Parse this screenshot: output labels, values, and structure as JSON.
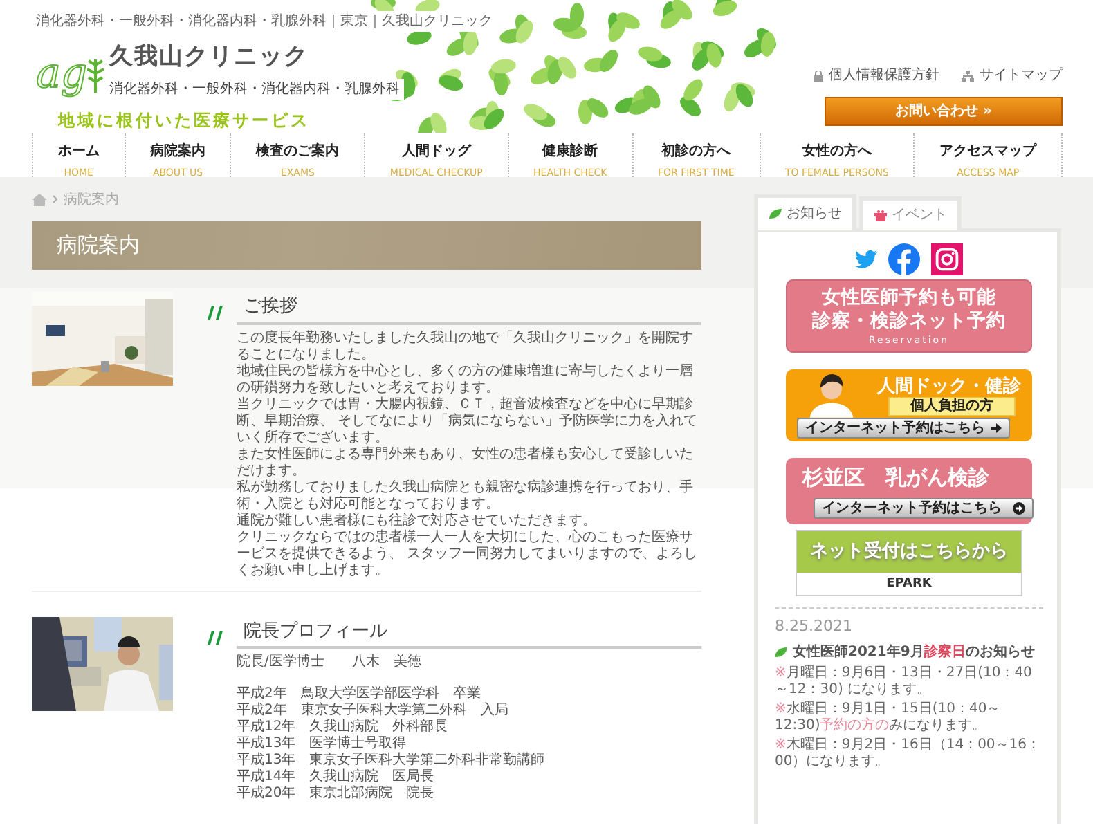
{
  "header": {
    "top_line": "消化器外科・一般外科・消化器内科・乳腺外科｜東京｜久我山クリニック",
    "logo_mark": "ag",
    "clinic_name": "久我山クリニック",
    "departments": "消化器外科・一般外科・消化器内科・乳腺外科",
    "slogan": "地域に根付いた医療サービス",
    "links": [
      "個人情報保護方針",
      "サイトマップ"
    ],
    "contact_button": "お問い合わせ »"
  },
  "nav": [
    {
      "label": "ホーム",
      "sublabel": "HOME"
    },
    {
      "label": "病院案内",
      "sublabel": "ABOUT US"
    },
    {
      "label": "検査のご案内",
      "sublabel": "EXAMS"
    },
    {
      "label": "人間ドッグ",
      "sublabel": "MEDICAL CHECKUP"
    },
    {
      "label": "健康診断",
      "sublabel": "HEALTH CHECK"
    },
    {
      "label": "初診の方へ",
      "sublabel": "FOR FIRST TIME"
    },
    {
      "label": "女性の方へ",
      "sublabel": "TO FEMALE PERSONS"
    },
    {
      "label": "アクセスマップ",
      "sublabel": "ACCESS MAP"
    }
  ],
  "breadcrumb": {
    "current": "病院案内"
  },
  "page_title": "病院案内",
  "sections": [
    {
      "heading": "ご挨拶",
      "paragraphs": [
        "この度長年勤務いたしました久我山の地で「久我山クリニック」を開院することになりました。",
        "地域住民の皆様方を中心とし、多くの方の健康増進に寄与したくより一層の研鑚努力を致したいと考えております。",
        "当クリニックでは胃・大腸内視鏡、ＣＴ，超音波検査などを中心に早期診断、早期治療、 そしてなにより「病気にならない」予防医学に力を入れていく所存でございます。",
        "また女性医師による専門外来もあり、女性の患者様も安心して受診しいただけます。",
        "私が勤務しておりました久我山病院とも親密な病診連携を行っており、手術・入院とも対応可能となっております。",
        "通院が難しい患者様にも往診で対応させていただきます。",
        "クリニックならではの患者様一人一人を大切にした、心のこもった医療サービスを提供できるよう、 スタッフ一同努力してまいりますので、よろしくお願い申し上げます。"
      ]
    },
    {
      "heading": "院長プロフィール",
      "lead": "院長/医学博士　　八木　美徳",
      "paragraphs": [
        "平成2年　鳥取大学医学部医学科　卒業",
        "平成2年　東京女子医科大学第二外科　入局",
        "平成12年　久我山病院　外科部長",
        "平成13年　医学博士号取得",
        "平成13年　東京女子医科大学第二外科非常勤講師",
        "平成14年　久我山病院　医局長",
        "平成20年　東京北部病院　院長"
      ]
    }
  ],
  "sidebar": {
    "tabs": [
      {
        "label": "お知らせ",
        "selected": true
      },
      {
        "label": "イベント",
        "selected": false
      }
    ],
    "banners": [
      {
        "kind": "reservation",
        "lines": [
          "女性医師予約も可能",
          "診察・検診ネット予約"
        ],
        "sub": "Reservation"
      },
      {
        "kind": "dock",
        "title": "人間ドック・健診",
        "label": "個人負担の方",
        "button": "インターネット予約はこちら"
      },
      {
        "kind": "screening",
        "title": "杉並区　乳がん検診",
        "button": "インターネット予約はこちら"
      },
      {
        "kind": "epark",
        "title": "ネット受付はこちらから",
        "logo": "EPARK"
      }
    ],
    "news": {
      "date": "8.25.2021",
      "title": [
        {
          "text": "女性医師2021年9月",
          "highlight": false
        },
        {
          "text": "診察日",
          "highlight": true
        },
        {
          "text": "のお知らせ",
          "highlight": false
        }
      ],
      "items": [
        [
          {
            "text": "※",
            "highlight": true
          },
          {
            "text": "月曜日：9月6日・13日・27日(10：40～12：30) になります。",
            "highlight": false
          }
        ],
        [
          {
            "text": "※",
            "highlight": true
          },
          {
            "text": "水曜日：9月1日・15日(10：40～12:30)",
            "highlight": false
          },
          {
            "text": "予約の方の",
            "highlight": true
          },
          {
            "text": "みになります。",
            "highlight": false
          }
        ],
        [
          {
            "text": "※",
            "highlight": true
          },
          {
            "text": "木曜日：9月2日・16日（14：00～16：00）になります。",
            "highlight": false
          }
        ]
      ]
    }
  }
}
